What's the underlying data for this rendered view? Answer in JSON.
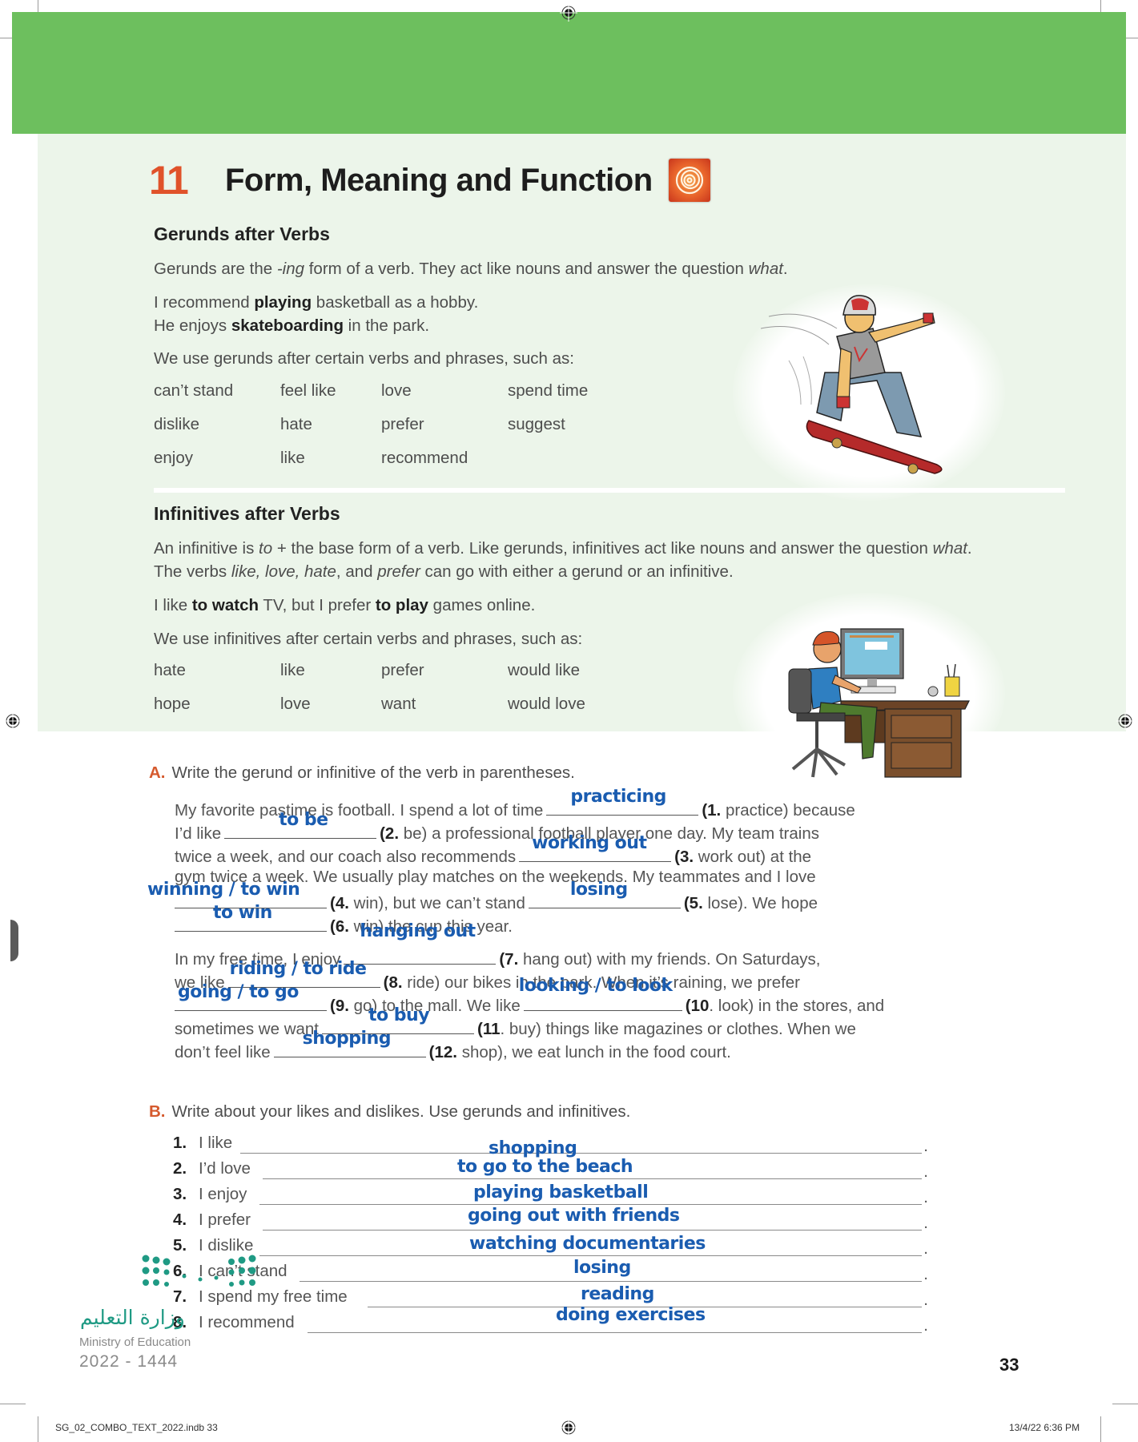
{
  "lesson": {
    "number": "11",
    "title": "Form, Meaning and Function",
    "icon": "spiral-icon"
  },
  "gerunds": {
    "heading": "Gerunds after Verbs",
    "intro_pre": "Gerunds are the ",
    "intro_ing": "-ing",
    "intro_mid": " form of a verb. They act like nouns and answer the question ",
    "intro_what": "what",
    "intro_end": ".",
    "example1_pre": "I recommend ",
    "example1_bold": "playing",
    "example1_post": " basketball as a hobby.",
    "example2_pre": "He enjoys ",
    "example2_bold": "skateboarding",
    "example2_post": " in the park.",
    "list_intro": "We use gerunds after certain verbs and phrases, such as:",
    "words": [
      [
        "can’t stand",
        "feel like",
        "love",
        "spend time"
      ],
      [
        "dislike",
        "hate",
        "prefer",
        "suggest"
      ],
      [
        "enjoy",
        "like",
        "recommend",
        ""
      ]
    ],
    "illustration": "skateboarder-illustration"
  },
  "infinitives": {
    "heading": "Infinitives after Verbs",
    "intro1_pre": "An infinitive is ",
    "intro1_to": "to",
    "intro1_mid": " + the base form of a verb. Like gerunds, infinitives act like nouns and answer the question ",
    "intro1_what": "what",
    "intro1_end": ".",
    "intro2_pre": "The verbs ",
    "intro2_verbs": "like, love, hate",
    "intro2_and": ", and ",
    "intro2_prefer": "prefer",
    "intro2_end": " can go with either a gerund or an infinitive.",
    "example_pre": "I like ",
    "example_bold1": "to watch",
    "example_mid": " TV, but I prefer ",
    "example_bold2": "to play",
    "example_post": " games online.",
    "list_intro": "We use infinitives after certain verbs and phrases, such as:",
    "words": [
      [
        "hate",
        "like",
        "prefer",
        "would like"
      ],
      [
        "hope",
        "love",
        "want",
        "would love"
      ]
    ],
    "illustration": "boy-at-computer-illustration"
  },
  "exercise_a": {
    "letter": "A.",
    "instruction": "Write the gerund or infinitive of the verb in parentheses.",
    "lines": [
      {
        "pre": "My favorite pastime is football. I spend a lot of time",
        "num": "(1.",
        "post": " practice) because",
        "answer": "practicing"
      },
      {
        "pre": "I’d like",
        "num": "(2.",
        "post": " be) a professional football player one day. My team trains",
        "answer": "to be"
      },
      {
        "pre": "twice a week, and our coach also recommends",
        "num": "(3.",
        "post": " work out) at the",
        "answer": "working out"
      },
      {
        "pre": "gym twice a week. We usually play matches on the weekends. My teammates and I love"
      },
      {
        "pre": "",
        "num": "(4.",
        "post": " win), but we can’t stand",
        "answer": "winning / to win",
        "num2": "(5.",
        "post2": " lose). We hope",
        "answer2": "losing"
      },
      {
        "pre": "",
        "num": "(6.",
        "post": " win) the cup this year.",
        "answer": "to win"
      },
      {
        "pre": "In my free time, I enjoy",
        "num": "(7.",
        "post": " hang out) with my friends. On Saturdays,",
        "answer": "hanging out"
      },
      {
        "pre": "we like",
        "num": "(8.",
        "post": " ride) our bikes in the park. When it’s raining, we prefer",
        "answer": "riding / to ride"
      },
      {
        "pre": "",
        "num": "(9.",
        "post": " go) to the mall. We like",
        "answer": "going / to go",
        "num2": "(10",
        "post2": ". look) in the stores, and",
        "answer2": "looking / to look"
      },
      {
        "pre": "sometimes we want",
        "num": "(11",
        "post": ". buy) things like magazines or clothes. When we",
        "answer": "to buy"
      },
      {
        "pre": "don’t feel like",
        "num": "(12.",
        "post": " shop), we eat lunch in the food court.",
        "answer": "shopping"
      }
    ]
  },
  "exercise_b": {
    "letter": "B.",
    "instruction": "Write about your likes and dislikes. Use gerunds and infinitives.",
    "items": [
      {
        "num": "1.",
        "stem": "I like",
        "answer": "shopping"
      },
      {
        "num": "2.",
        "stem": "I’d love",
        "answer": "to go to the beach"
      },
      {
        "num": "3.",
        "stem": "I enjoy",
        "answer": "playing basketball"
      },
      {
        "num": "4.",
        "stem": "I prefer",
        "answer": "going out with friends"
      },
      {
        "num": "5.",
        "stem": "I dislike",
        "answer": "watching documentaries"
      },
      {
        "num": "6.",
        "stem": "I can’t stand",
        "answer": "losing"
      },
      {
        "num": "7.",
        "stem": "I spend my free time",
        "answer": "reading"
      },
      {
        "num": "8.",
        "stem": "I recommend",
        "answer": "doing exercises"
      }
    ],
    "end_mark": "."
  },
  "footer": {
    "ministry_arabic": "وزارة التعليم",
    "ministry_english": "Ministry of Education",
    "year": "2022 - 1444",
    "page_number": "33",
    "slug_file": "SG_02_COMBO_TEXT_2022.indb   33",
    "slug_date": "13/4/22   6:36 PM"
  },
  "colors": {
    "band_green": "#6dbf5e",
    "panel_green": "#ecf5ea",
    "accent_orange": "#e0522a",
    "answer_blue": "#1a5cb0",
    "logo_teal": "#1f9a84"
  }
}
